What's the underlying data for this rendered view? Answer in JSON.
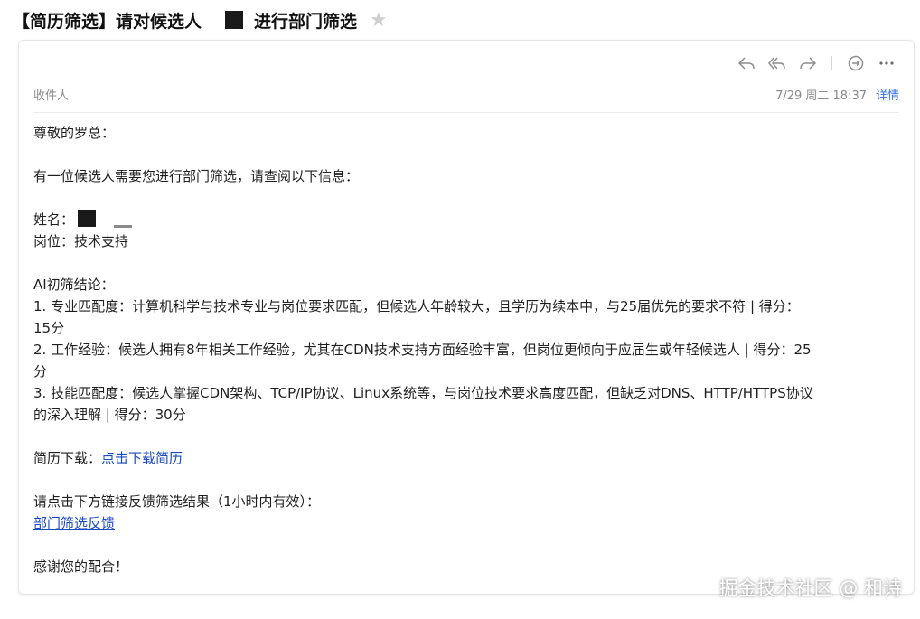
{
  "email": {
    "subject_prefix": "【简历筛选】请对候选人",
    "subject_suffix": "进行部门筛选",
    "recipient_label": "收件人",
    "timestamp": "7/29 周二 18:37",
    "details_label": "详情"
  },
  "toolbar": {
    "reply": "reply-icon",
    "reply_all": "reply-all-icon",
    "forward": "forward-icon",
    "comment": "comment-icon",
    "more": "more-icon"
  },
  "body": {
    "greeting": "尊敬的罗总：",
    "intro": "有一位候选人需要您进行部门筛选，请查阅以下信息：",
    "name_label": "姓名：",
    "position_line": "岗位：技术支持",
    "ai_title": "AI初筛结论：",
    "item1": "1. 专业匹配度：计算机科学与技术专业与岗位要求匹配，但候选人年龄较大，且学历为续本中，与25届优先的要求不符 | 得分：",
    "item1_tail": "15分",
    "item2": "2. 工作经验：候选人拥有8年相关工作经验，尤其在CDN技术支持方面经验丰富，但岗位更倾向于应届生或年轻候选人 | 得分：25",
    "item2_tail": "分",
    "item3": "3. 技能匹配度：候选人掌握CDN架构、TCP/IP协议、Linux系统等，与岗位技术要求高度匹配，但缺乏对DNS、HTTP/HTTPS协议",
    "item3_tail": "的深入理解 | 得分：30分",
    "download_label": "简历下载：",
    "download_link": "点击下载简历",
    "feedback_prompt": "请点击下方链接反馈筛选结果（1小时内有效）：",
    "feedback_link": "部门筛选反馈",
    "thanks": "感谢您的配合！"
  },
  "watermark": "掘金技术社区 @ 和诗",
  "colors": {
    "link": "#1a49c4",
    "details": "#2f6fe0",
    "meta": "#8a8a8a"
  }
}
